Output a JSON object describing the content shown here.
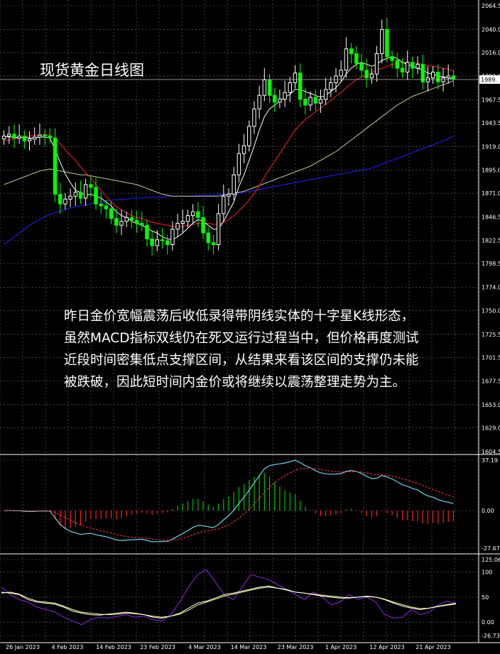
{
  "title": "现货黄金日线图",
  "comment_lines": [
    "昨日金价宽幅震荡后收低录得带阴线实体的十字星K线形态，",
    "虽然MACD指标双线仍在死叉运行过程当中，但价格再度测试",
    "近段时间密集低点支撑区间，从结果来看该区间的支撑仍未能",
    "被跌破，因此短时间内金价或将继续以震荡整理走势为主。"
  ],
  "colors": {
    "background": "#000000",
    "grid": "#6a6a6a",
    "bull_candle": "#ffffff",
    "bear_candle": "#00ff00",
    "ma_fast": "#ffffff",
    "ma_mid": "#ff2020",
    "ma_slow": "#c8c89a",
    "ma_long": "#2020ff",
    "macd_line": "#6fd4ee",
    "macd_signal": "#ff3b3b",
    "hist_pos": "#00c000",
    "hist_neg": "#ff2020",
    "rsi_a": "#ffffff",
    "rsi_b": "#ffff80",
    "rsi_c": "#8a2be2"
  },
  "chart_data": [
    {
      "type": "candlestick",
      "name": "price",
      "x_labels": [
        "26 Jan 2023",
        "4 Feb 2023",
        "14 Feb 2023",
        "23 Feb 2023",
        "4 Mar 2023",
        "14 Mar 2023",
        "23 Mar 2023",
        "1 Apr 2023",
        "12 Apr 2023",
        "21 Apr 2023"
      ],
      "y_ticks": [
        "2064.5",
        "2040.0",
        "2016.0",
        "1992.0",
        "1967.5",
        "1943.5",
        "1919.0",
        "1895.0",
        "1871.0",
        "1846.5",
        "1822.5",
        "1798.5",
        "1774.0",
        "1750.0",
        "1725.5",
        "1701.5",
        "1677.5",
        "1653.0",
        "1629.0",
        "1604.5"
      ],
      "current_price_label": "1989.",
      "ylim": [
        1604.5,
        2064.5
      ],
      "close": [
        1930,
        1932,
        1928,
        1930,
        1925,
        1927,
        1929,
        1931,
        1930,
        1928,
        1870,
        1860,
        1865,
        1868,
        1872,
        1866,
        1880,
        1877,
        1860,
        1858,
        1855,
        1845,
        1838,
        1842,
        1846,
        1843,
        1840,
        1838,
        1824,
        1817,
        1823,
        1822,
        1818,
        1834,
        1840,
        1842,
        1848,
        1852,
        1846,
        1830,
        1820,
        1818,
        1850,
        1868,
        1870,
        1890,
        1912,
        1920,
        1940,
        1958,
        1972,
        1988,
        1972,
        1965,
        1968,
        1975,
        1985,
        1995,
        1968,
        1962,
        1970,
        1964,
        1968,
        1978,
        1985,
        1992,
        1998,
        2020,
        2015,
        2005,
        1998,
        1990,
        1994,
        2015,
        2040,
        2012,
        2008,
        2000,
        1996,
        2006,
        2000,
        2004,
        1986,
        1990,
        1996,
        1986,
        1990,
        1992,
        1989
      ],
      "ma_fast": [
        1930,
        1929,
        1929,
        1928,
        1929,
        1928,
        1928,
        1929,
        1929,
        1928,
        1916,
        1903,
        1891,
        1882,
        1874,
        1872,
        1869,
        1870,
        1868,
        1866,
        1862,
        1858,
        1852,
        1848,
        1846,
        1842,
        1840,
        1838,
        1835,
        1832,
        1830,
        1826,
        1824,
        1823,
        1826,
        1830,
        1835,
        1840,
        1844,
        1842,
        1838,
        1834,
        1834,
        1842,
        1852,
        1862,
        1878,
        1890,
        1905,
        1920,
        1936,
        1950,
        1958,
        1962,
        1966,
        1970,
        1973,
        1978,
        1978,
        1976,
        1974,
        1972,
        1970,
        1972,
        1976,
        1980,
        1986,
        1994,
        2000,
        2004,
        2006,
        2004,
        2002,
        2004,
        2008,
        2010,
        2012,
        2010,
        2006,
        2004,
        2002,
        2000,
        1998,
        1995,
        1994,
        1992,
        1991,
        1990,
        1989
      ],
      "ma_mid": [
        1925,
        1926,
        1927,
        1928,
        1929,
        1930,
        1931,
        1931,
        1932,
        1931,
        1927,
        1922,
        1916,
        1910,
        1905,
        1898,
        1892,
        1887,
        1880,
        1874,
        1868,
        1862,
        1857,
        1854,
        1851,
        1848,
        1846,
        1845,
        1843,
        1841,
        1840,
        1839,
        1838,
        1837,
        1836,
        1837,
        1838,
        1839,
        1840,
        1840,
        1840,
        1839,
        1839,
        1841,
        1844,
        1848,
        1853,
        1858,
        1864,
        1871,
        1879,
        1888,
        1896,
        1904,
        1912,
        1920,
        1928,
        1936,
        1942,
        1947,
        1951,
        1955,
        1959,
        1963,
        1967,
        1971,
        1975,
        1980,
        1984,
        1988,
        1991,
        1993,
        1995,
        1998,
        2000,
        2002,
        2004,
        2005,
        2006,
        2006,
        2006,
        2005,
        2004,
        2003,
        2002,
        2001,
        2000,
        1999,
        1997
      ],
      "ma_slow": [
        1880,
        1882,
        1884,
        1886,
        1888,
        1890,
        1892,
        1894,
        1895,
        1896,
        1895,
        1894,
        1893,
        1892,
        1891,
        1890,
        1890,
        1889,
        1888,
        1887,
        1886,
        1885,
        1884,
        1883,
        1882,
        1881,
        1880,
        1878,
        1876,
        1874,
        1872,
        1870,
        1869,
        1868,
        1868,
        1868,
        1868,
        1868,
        1868,
        1868,
        1868,
        1868,
        1868,
        1869,
        1870,
        1871,
        1872,
        1873,
        1875,
        1877,
        1879,
        1881,
        1883,
        1885,
        1887,
        1889,
        1891,
        1893,
        1895,
        1897,
        1899,
        1902,
        1905,
        1908,
        1911,
        1914,
        1918,
        1922,
        1926,
        1930,
        1934,
        1938,
        1942,
        1946,
        1950,
        1954,
        1958,
        1962,
        1965,
        1968,
        1971,
        1973,
        1975,
        1977,
        1979,
        1981,
        1983,
        1985,
        1987
      ],
      "ma_long": [
        1818,
        1822,
        1826,
        1830,
        1834,
        1838,
        1841,
        1844,
        1847,
        1849,
        1851,
        1853,
        1854,
        1856,
        1857,
        1858,
        1859,
        1860,
        1861,
        1862,
        1863,
        1864,
        1864,
        1865,
        1865,
        1866,
        1866,
        1866,
        1867,
        1867,
        1867,
        1867,
        1868,
        1868,
        1868,
        1868,
        1868,
        1868,
        1869,
        1869,
        1869,
        1869,
        1870,
        1870,
        1870,
        1871,
        1871,
        1872,
        1873,
        1874,
        1875,
        1876,
        1877,
        1878,
        1879,
        1880,
        1881,
        1882,
        1883,
        1884,
        1885,
        1886,
        1887,
        1888,
        1889,
        1890,
        1891,
        1892,
        1893,
        1894,
        1895,
        1896,
        1897,
        1899,
        1901,
        1903,
        1905,
        1907,
        1909,
        1911,
        1913,
        1915,
        1917,
        1919,
        1921,
        1923,
        1925,
        1927,
        1930
      ]
    },
    {
      "type": "macd",
      "name": "MACD",
      "y_ticks": [
        "37.19",
        "0.00",
        "-27.67"
      ],
      "ylim": [
        -27.67,
        37.19
      ]
    },
    {
      "type": "oscillator",
      "name": "oscillator",
      "y_ticks": [
        "125.06",
        "100",
        "50",
        "0.00",
        "-26.73"
      ],
      "ylim": [
        -26.73,
        125.06
      ],
      "line_a": [
        60,
        58,
        55,
        45,
        40,
        38,
        36,
        30,
        22,
        18,
        15,
        14,
        16,
        18,
        20,
        18,
        15,
        10,
        8,
        12,
        18,
        28,
        38,
        42,
        48,
        55,
        58,
        62,
        66,
        70,
        72,
        68,
        65,
        60,
        58,
        55,
        52,
        50,
        48,
        48,
        50,
        52,
        50,
        45,
        38,
        32,
        28,
        25,
        28,
        32,
        35,
        38
      ],
      "line_b": [
        58,
        60,
        56,
        48,
        42,
        40,
        38,
        32,
        25,
        20,
        18,
        16,
        15,
        16,
        18,
        17,
        15,
        12,
        10,
        12,
        16,
        24,
        34,
        40,
        46,
        52,
        56,
        60,
        64,
        68,
        70,
        68,
        64,
        60,
        58,
        56,
        54,
        52,
        50,
        49,
        50,
        51,
        50,
        46,
        40,
        35,
        30,
        27,
        28,
        31,
        34,
        36
      ],
      "line_c": [
        70,
        55,
        45,
        40,
        30,
        25,
        20,
        10,
        2,
        -5,
        5,
        10,
        8,
        12,
        15,
        10,
        12,
        5,
        2,
        15,
        40,
        70,
        95,
        105,
        80,
        55,
        45,
        70,
        95,
        90,
        85,
        75,
        65,
        55,
        45,
        60,
        50,
        35,
        40,
        55,
        45,
        50,
        40,
        15,
        8,
        10,
        25,
        15,
        20,
        35,
        42,
        38
      ]
    }
  ]
}
